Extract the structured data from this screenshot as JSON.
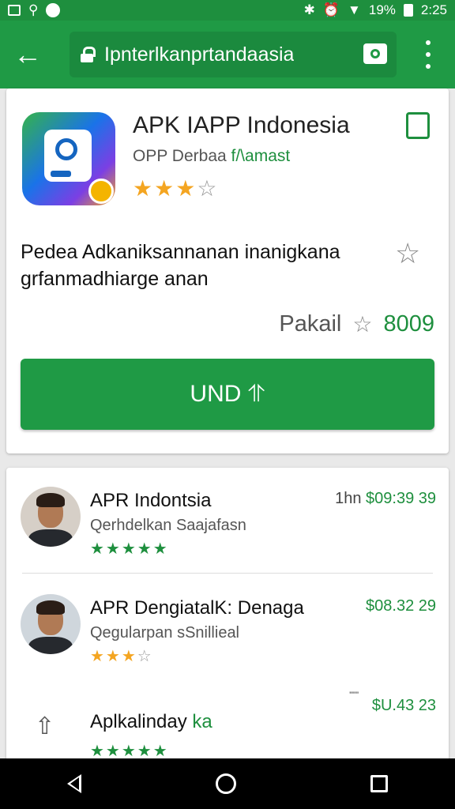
{
  "status_bar": {
    "icons_left": [
      "image-icon",
      "location-icon",
      "messenger-icon"
    ],
    "battery": "19%",
    "time": "2:25"
  },
  "app_bar": {
    "url": "Ipnterlkanprtandaasia"
  },
  "app_card": {
    "title": "APK IAPP Indonesia",
    "developer_prefix": "OPP Derbaa ",
    "developer_suffix": "f/\\amast",
    "rating": 3.5,
    "stars_display": "★★★",
    "stars_empty": "☆",
    "description": "Pedea Adkaniksannanan inanigkana grfanmadhiarge anan",
    "pakai_label": "Pakail",
    "pakai_count": "8009",
    "install_label": "UND ⥣"
  },
  "reviews": [
    {
      "name": "APR Indontsia",
      "subtitle": "Qerhdelkan Saajafasn",
      "time_gray": "1hn ",
      "time_green": "$09:39 39",
      "stars": "★★★★★",
      "rating": 5
    },
    {
      "name": "APR DengiatalK: Denaga",
      "subtitle": "Qegularpan sSnillieal",
      "time_green": "$08.32 29",
      "stars": "★★★",
      "stars_empty": "☆",
      "rating": 3
    },
    {
      "name": "Aplkalinday ",
      "name_green": "ka",
      "mark": "\"\"\"",
      "time_green": "$U.43 23",
      "stars": "★★★★★",
      "rating": 5
    }
  ],
  "colors": {
    "accent": "#1f9a45",
    "star": "#f4a521",
    "text_green": "#1e8f3e"
  }
}
